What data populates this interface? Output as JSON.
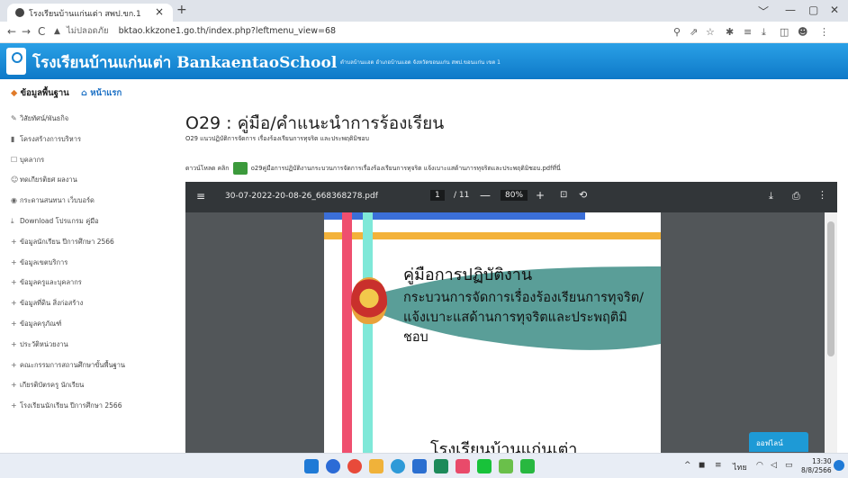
{
  "browser": {
    "tab_title": "โรงเรียนบ้านแก่นเต่า สพป.ขก.1",
    "tab_close": "×",
    "new_tab": "+",
    "window_controls": [
      "﹀",
      "—",
      "▢",
      "✕"
    ],
    "nav": {
      "back": "←",
      "forward": "→",
      "reload": "C"
    },
    "security_label": "ไม่ปลอดภัย",
    "url": "bktao.kkzone1.go.th/index.php?leftmenu_view=68"
  },
  "site": {
    "name": "โรงเรียนบ้านแก่นเต่า BankaentaoSchool",
    "subtitle": "ตำบลบ้านแฮด อำเภอบ้านแฮด จังหวัดขอนแก่น สพป.ขอนแก่น เขต 1"
  },
  "sidebar": {
    "header": "ข้อมูลพื้นฐาน",
    "home": "หน้าแรก",
    "items": [
      {
        "icon": "✎",
        "label": "วิสัยทัศน์/พันธกิจ"
      },
      {
        "icon": "▮",
        "label": "โครงสร้างการบริหาร"
      },
      {
        "icon": "☐",
        "label": "บุคลากร"
      },
      {
        "icon": "☺",
        "label": "ทดเกียรติยศ ผลงาน"
      },
      {
        "icon": "◉",
        "label": "กระดานสนทนา เว็บบอร์ด"
      },
      {
        "icon": "⤓",
        "label": "Download โปรแกรม คู่มือ"
      },
      {
        "icon": "+",
        "label": "ข้อมูลนักเรียน ปีการศึกษา 2566"
      },
      {
        "icon": "+",
        "label": "ข้อมูลเขตบริการ"
      },
      {
        "icon": "+",
        "label": "ข้อมูลครูและบุคลากร"
      },
      {
        "icon": "+",
        "label": "ข้อมูลที่ดิน สิ่งก่อสร้าง"
      },
      {
        "icon": "+",
        "label": "ข้อมูลครุภัณฑ์"
      },
      {
        "icon": "+",
        "label": "ประวัติหน่วยงาน"
      },
      {
        "icon": "+",
        "label": "คณะกรรมการสถานศึกษาขั้นพื้นฐาน"
      },
      {
        "icon": "+",
        "label": "เกียรติบัตรครู นักเรียน"
      },
      {
        "icon": "+",
        "label": "โรงเรียนนักเรียน ปีการศึกษา 2566"
      }
    ]
  },
  "main": {
    "title": "O29 : คู่มือ/คำแนะนำการร้องเรียน",
    "subtitle": "O29   แนวปฏิบัติการจัดการ เรื่องร้องเรียนการทุจริต และประพฤติมิชอบ",
    "download_prefix": "ดาวน์โหลด คลิก",
    "download_link": "o29คู่มือการปฏิบัติงานกระบวนการจัดการเรื่องร้องเรียนการทุจริต แจ้งเบาะแสด้านการทุจริตและประพฤติมิชอบ.pdfที่นี่"
  },
  "pdf": {
    "filename": "30-07-2022-20-08-26_668368278.pdf",
    "page_current": "1",
    "page_total": "/ 11",
    "zoom": "80%",
    "page_heading": "คู่มือการปฏิบัติงาน",
    "page_subheading": "กระบวนการจัดการเรื่องร้องเรียนการทุจริต/ แจ้งเบาะแสด้านการทุจริตและประพฤติมิ ชอบ",
    "page_school": "โรงเรียนบ้านแก่นเต่า"
  },
  "chat_widget": "ออฟไลน์",
  "taskbar": {
    "tray_text": "ไทย",
    "time": "13:30",
    "date": "8/8/2566"
  },
  "colors": {
    "header_blue": "#1b8fd8",
    "pdf_toolbar": "#323639",
    "pdf_background": "#525659",
    "stripe_pink": "#ef4f6f",
    "stripe_mint": "#7fe8d8",
    "stripe_orange": "#f3b23a",
    "stripe_blue": "#3b6fd8",
    "wave_teal": "#5a9e98"
  }
}
